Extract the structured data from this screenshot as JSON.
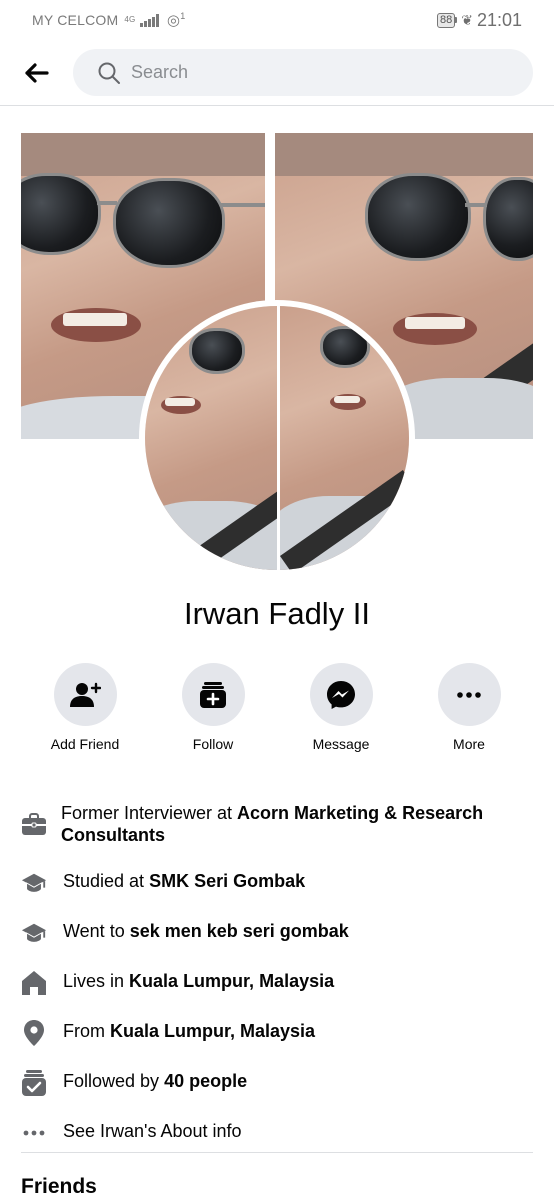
{
  "status_bar": {
    "carrier": "MY CELCOM",
    "network": "4G",
    "hotspot_count": "1",
    "battery": "88",
    "time": "21:01"
  },
  "top_bar": {
    "search_placeholder": "Search"
  },
  "profile": {
    "name": "Irwan Fadly II"
  },
  "actions": [
    {
      "label": "Add Friend",
      "icon": "add-friend-icon"
    },
    {
      "label": "Follow",
      "icon": "follow-icon"
    },
    {
      "label": "Message",
      "icon": "messenger-icon"
    },
    {
      "label": "More",
      "icon": "more-icon"
    }
  ],
  "details": {
    "work": {
      "prefix": "Former Interviewer at ",
      "bold": "Acorn Marketing & Research Consultants"
    },
    "studied": {
      "prefix": "Studied at ",
      "bold": "SMK Seri Gombak"
    },
    "went": {
      "prefix": "Went to ",
      "bold": "sek men keb seri gombak"
    },
    "lives": {
      "prefix": "Lives in ",
      "bold": "Kuala Lumpur, Malaysia"
    },
    "from": {
      "prefix": "From ",
      "bold": "Kuala Lumpur, Malaysia"
    },
    "followed": {
      "prefix": "Followed by ",
      "bold": "40 people"
    },
    "about": {
      "text": "See Irwan's About info"
    }
  },
  "friends": {
    "title": "Friends"
  },
  "colors": {
    "icon_dark": "#050505",
    "icon_grey": "#65676b",
    "button_bg": "#e4e6eb",
    "search_bg": "#f0f2f5",
    "divider": "#dddfe2"
  }
}
